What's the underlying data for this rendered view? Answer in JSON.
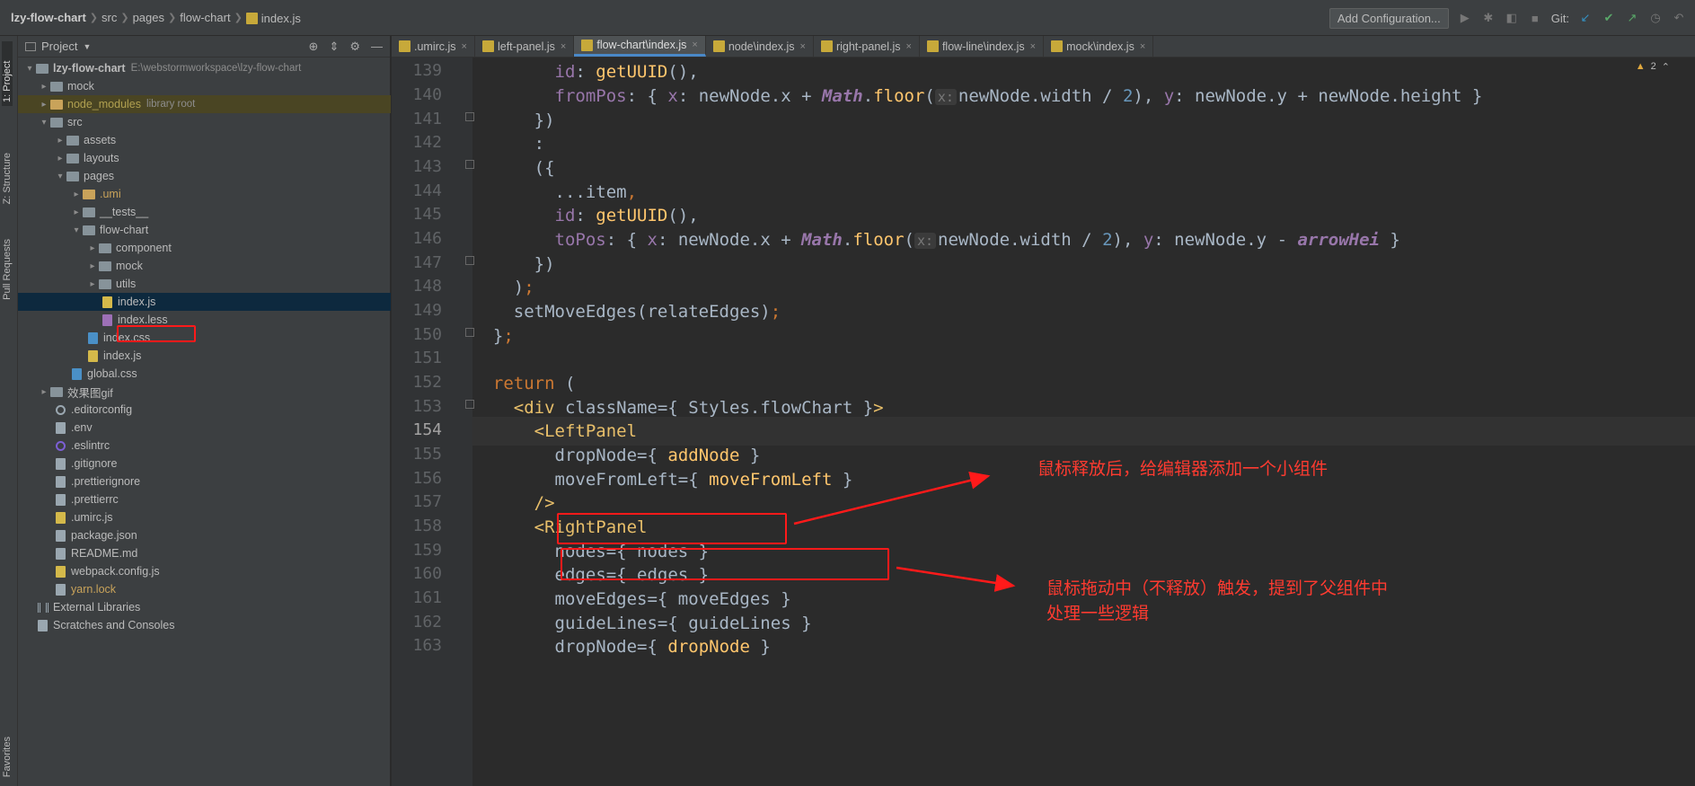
{
  "breadcrumb": [
    "lzy-flow-chart",
    "src",
    "pages",
    "flow-chart",
    "index.js"
  ],
  "toolbar": {
    "add_config_label": "Add Configuration...",
    "git_label": "Git:"
  },
  "tool_strip": {
    "project": "1: Project",
    "structure": "Z: Structure",
    "pull_requests": "Pull Requests",
    "favorites": "Favorites"
  },
  "project_panel": {
    "title": "Project",
    "tree": [
      {
        "label": "lzy-flow-chart",
        "extra": "E:\\webstormworkspace\\lzy-flow-chart"
      },
      {
        "label": "mock"
      },
      {
        "label": "node_modules",
        "extra": "library root"
      },
      {
        "label": "src"
      },
      {
        "label": "assets"
      },
      {
        "label": "layouts"
      },
      {
        "label": "pages"
      },
      {
        "label": ".umi"
      },
      {
        "label": "__tests__"
      },
      {
        "label": "flow-chart"
      },
      {
        "label": "component"
      },
      {
        "label": "mock"
      },
      {
        "label": "utils"
      },
      {
        "label": "index.js"
      },
      {
        "label": "index.less"
      },
      {
        "label": "index.css"
      },
      {
        "label": "index.js"
      },
      {
        "label": "global.css"
      },
      {
        "label": "效果图gif"
      },
      {
        "label": ".editorconfig"
      },
      {
        "label": ".env"
      },
      {
        "label": ".eslintrc"
      },
      {
        "label": ".gitignore"
      },
      {
        "label": ".prettierignore"
      },
      {
        "label": ".prettierrc"
      },
      {
        "label": ".umirc.js"
      },
      {
        "label": "package.json"
      },
      {
        "label": "README.md"
      },
      {
        "label": "webpack.config.js"
      },
      {
        "label": "yarn.lock"
      },
      {
        "label": "External Libraries"
      },
      {
        "label": "Scratches and Consoles"
      }
    ]
  },
  "tabs": [
    {
      "label": ".umirc.js"
    },
    {
      "label": "left-panel.js"
    },
    {
      "label": "flow-chart\\index.js"
    },
    {
      "label": "node\\index.js"
    },
    {
      "label": "right-panel.js"
    },
    {
      "label": "flow-line\\index.js"
    },
    {
      "label": "mock\\index.js"
    }
  ],
  "editor": {
    "warning_count": "2",
    "line_numbers": [
      "139",
      "140",
      "141",
      "142",
      "143",
      "144",
      "145",
      "146",
      "147",
      "148",
      "149",
      "150",
      "151",
      "152",
      "153",
      "154",
      "155",
      "156",
      "157",
      "158",
      "159",
      "160",
      "161",
      "162",
      "163"
    ],
    "current_line": "154",
    "code": {
      "l139": [
        "id",
        ": ",
        "getUUID",
        "(),"
      ],
      "l140": [
        "fromPos",
        ": { ",
        "x",
        ": newNode.x + ",
        "Math",
        ".",
        "floor",
        "(",
        "x:",
        "newNode.width / ",
        "2",
        "), ",
        "y",
        ": newNode.y + newNode.height }"
      ],
      "l141": "})",
      "l142": ":",
      "l143": "({",
      "l144": [
        "...item",
        ","
      ],
      "l145": [
        "id",
        ": ",
        "getUUID",
        "(),"
      ],
      "l146": [
        "toPos",
        ": { ",
        "x",
        ": newNode.x + ",
        "Math",
        ".",
        "floor",
        "(",
        "x:",
        "newNode.width / ",
        "2",
        "), ",
        "y",
        ": newNode.y - ",
        "arrowHei",
        " }"
      ],
      "l147": "})",
      "l148": [
        ")",
        ";"
      ],
      "l149": [
        "setMoveEdges(relateEdges)",
        ";"
      ],
      "l150": [
        "}",
        ";"
      ],
      "l151": "",
      "l152": [
        "return",
        " ("
      ],
      "l153": [
        "<div",
        " className",
        "=",
        "{ Styles.flowChart }",
        ">"
      ],
      "l154": [
        "<LeftPanel"
      ],
      "l155": [
        "dropNode",
        "=",
        "{ ",
        "addNode",
        " }"
      ],
      "l156": [
        "moveFromLeft",
        "=",
        "{ ",
        "moveFromLeft",
        " }"
      ],
      "l157": [
        "/>"
      ],
      "l158": [
        "<RightPanel"
      ],
      "l159": [
        "nodes",
        "=",
        "{ nodes }"
      ],
      "l160": [
        "edges",
        "=",
        "{ edges }"
      ],
      "l161": [
        "moveEdges",
        "=",
        "{ moveEdges }"
      ],
      "l162": [
        "guideLines",
        "=",
        "{ guideLines }"
      ],
      "l163": [
        "dropNode",
        "=",
        "{ ",
        "dropNode",
        " }"
      ]
    }
  },
  "annotations": {
    "note1": "鼠标释放后，给编辑器添加一个小组件",
    "note2_line1": "鼠标拖动中（不释放）触发，提到了父组件中",
    "note2_line2": "处理一些逻辑"
  },
  "colors": {
    "annotation_red": "#ff1a1a",
    "keyword": "#cc7832",
    "function": "#ffc66d",
    "property": "#9876aa",
    "number": "#6897bb"
  }
}
